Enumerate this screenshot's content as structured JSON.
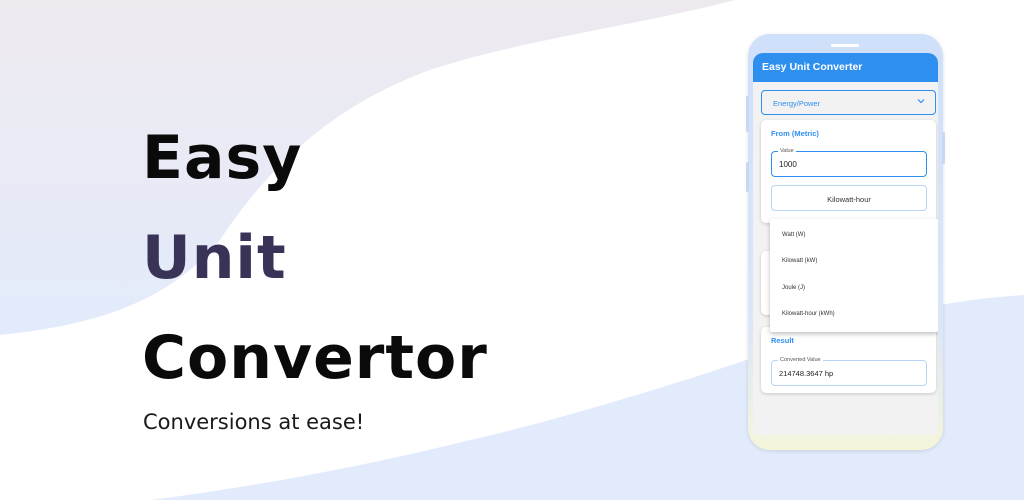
{
  "hero": {
    "line1": "Easy",
    "line2": "Unit",
    "line3": "Convertor",
    "tagline": "Conversions at ease!"
  },
  "app": {
    "title": "Easy Unit Converter",
    "category": "Energy/Power",
    "from": {
      "title": "From (Metric)",
      "value_label": "Value",
      "value": "1000",
      "unit": "Kilowatt-hour"
    },
    "dropdown_options": [
      "Watt (W)",
      "Kilowatt (kW)",
      "Joule (J)",
      "Kilowatt-hour (kWh)"
    ],
    "result": {
      "title": "Result",
      "label": "Converted Value",
      "value": "214748.3647 hp"
    }
  },
  "colors": {
    "accent": "#2e8fef",
    "hero_unit": "#3a3358",
    "text": "#0a0a0a"
  },
  "icons": {
    "category_dropdown": "chevron-down-icon"
  }
}
